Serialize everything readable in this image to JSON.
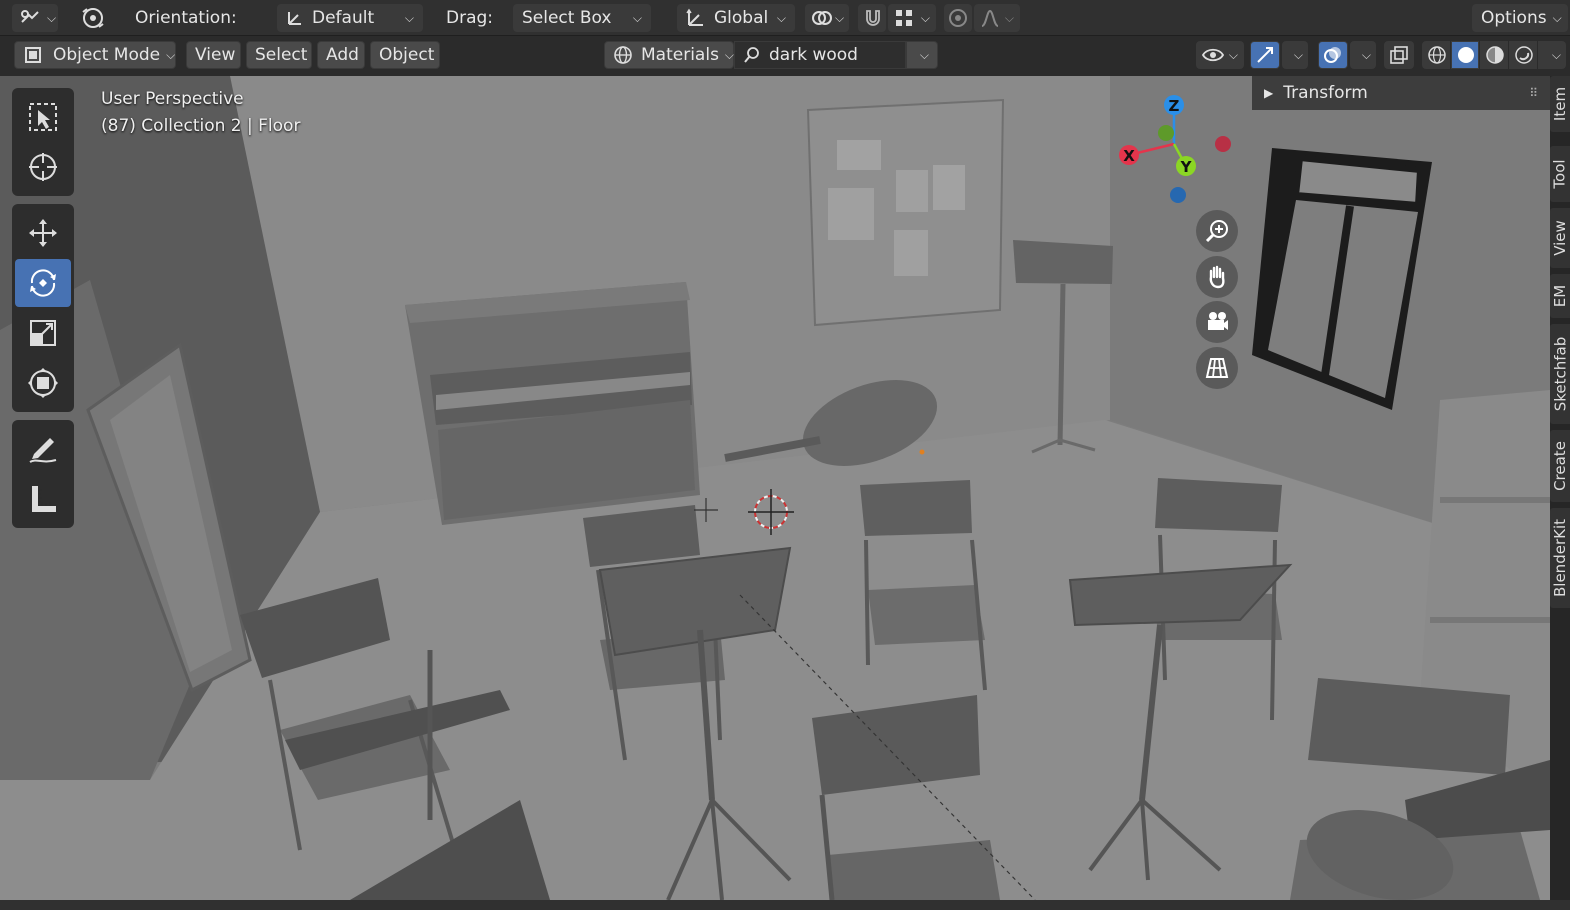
{
  "topbar": {
    "orientation_label": "Orientation:",
    "orientation_value": "Default",
    "drag_label": "Drag:",
    "drag_value": "Select Box",
    "transform_space": "Global",
    "options_label": "Options"
  },
  "header": {
    "mode": "Object Mode",
    "menu": [
      "View",
      "Select",
      "Add",
      "Object"
    ],
    "browser_type": "Materials",
    "search_value": "dark wood"
  },
  "viewport": {
    "view_name": "User Perspective",
    "collection_info": "(87) Collection 2 | Floor",
    "gizmo": {
      "x": "X",
      "y": "Y",
      "z": "Z"
    },
    "colors": {
      "x_axis": "#e3354c",
      "y_axis": "#8bd624",
      "z_axis": "#2a8fe8",
      "accent": "#4772b3"
    }
  },
  "tools": [
    "select-box",
    "cursor",
    "move",
    "rotate",
    "scale",
    "transform",
    "annotate",
    "measure"
  ],
  "npanel": {
    "transform_label": "Transform"
  },
  "sidetabs": [
    "Item",
    "Tool",
    "View",
    "EM",
    "Sketchfab",
    "Create",
    "BlenderKit"
  ]
}
